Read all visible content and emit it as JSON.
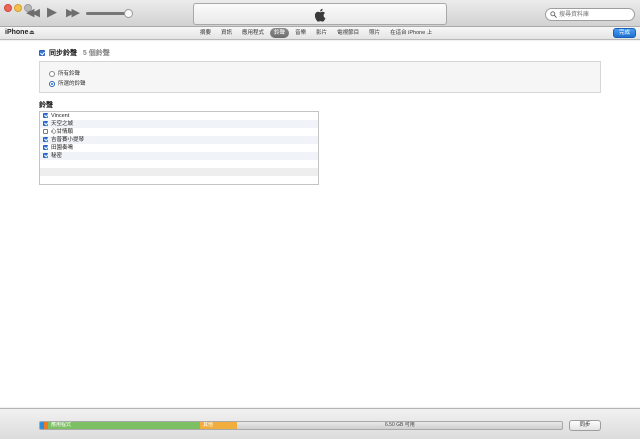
{
  "toolbar": {
    "search": {
      "placeholder": "搜尋資料庫"
    }
  },
  "navbar": {
    "device_name": "iPhone",
    "tabs": [
      {
        "label": "摘要",
        "active": false
      },
      {
        "label": "資訊",
        "active": false
      },
      {
        "label": "應用程式",
        "active": false
      },
      {
        "label": "鈴聲",
        "active": true
      },
      {
        "label": "音樂",
        "active": false
      },
      {
        "label": "影片",
        "active": false
      },
      {
        "label": "電視節目",
        "active": false
      },
      {
        "label": "照片",
        "active": false
      },
      {
        "label": "在這台 iPhone 上",
        "active": false
      }
    ],
    "done_label": "完成"
  },
  "main": {
    "sync_label": "同步鈴聲",
    "sync_count": "5 個鈴聲",
    "sync_checked": true,
    "options": [
      {
        "label": "所有鈴聲",
        "selected": false
      },
      {
        "label": "所選的鈴聲",
        "selected": true
      }
    ],
    "ringtones_heading": "鈴聲",
    "ringtones": [
      {
        "name": "Vincent",
        "checked": true
      },
      {
        "name": "天空之城",
        "checked": true
      },
      {
        "name": "心甘情願",
        "checked": false
      },
      {
        "name": "吉普賽小提琴",
        "checked": true
      },
      {
        "name": "田園奏鳴",
        "checked": true
      },
      {
        "name": "秘密",
        "checked": true
      }
    ]
  },
  "bottom": {
    "capacity": {
      "apps_label": "應用程式",
      "other_label": "其他",
      "free_label": "6.50 GB 可用"
    },
    "sync_button": "同步"
  },
  "colors": {
    "accent": "#2a6fd1",
    "audio": "#2b8fde",
    "photos": "#f07a23",
    "apps": "#7cc063",
    "other": "#f2ad3f"
  }
}
